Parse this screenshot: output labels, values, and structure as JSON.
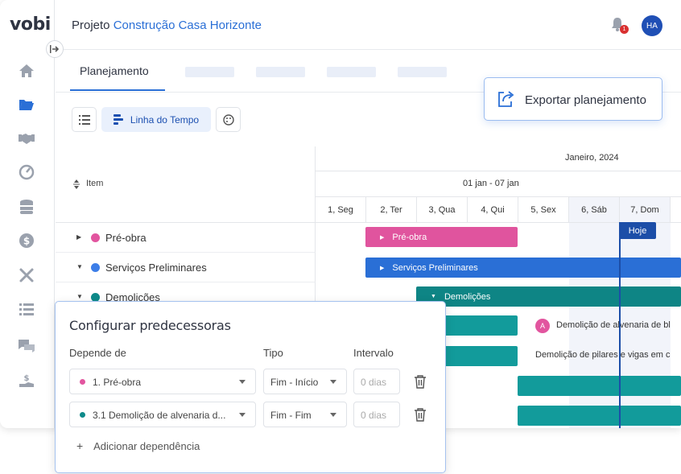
{
  "app": {
    "logo": "vobi"
  },
  "header": {
    "project_label": "Projeto",
    "project_name": "Construção Casa Horizonte",
    "notification_count": "1",
    "user_initials": "HA"
  },
  "tabs": {
    "active_label": "Planejamento"
  },
  "toolbar": {
    "timeline_label": "Linha do Tempo"
  },
  "export": {
    "label": "Exportar planejamento"
  },
  "grid": {
    "item_header": "Item",
    "month": "Janeiro, 2024",
    "week": "01 jan - 07 jan",
    "days": [
      "1, Seg",
      "2, Ter",
      "3, Qua",
      "4, Qui",
      "5, Sex",
      "6, Sáb",
      "7, Dom"
    ],
    "rows": [
      {
        "label": "Pré-obra",
        "color": "#e2559f",
        "expanded": false
      },
      {
        "label": "Serviços Preliminares",
        "color": "#3d7ee8",
        "expanded": true
      },
      {
        "label": "Demolições",
        "color": "#0e8a8a",
        "expanded": true
      }
    ],
    "bars": [
      {
        "label": "Pré-obra",
        "color": "#e0549e"
      },
      {
        "label": "Serviços Preliminares",
        "color": "#2a6fd6"
      },
      {
        "label": "Demolições",
        "color": "#0e8585"
      }
    ],
    "task_texts": [
      {
        "avatar": "A",
        "text": "Demolição de alvenaria de bl"
      },
      {
        "text": "Demolição de pilares e vigas em c"
      }
    ],
    "today_label": "Hoje"
  },
  "modal": {
    "title": "Configurar predecessoras",
    "col_depends": "Depende de",
    "col_type": "Tipo",
    "col_interval": "Intervalo",
    "rows": [
      {
        "depends": "1. Pré-obra",
        "dot_color": "#e2559f",
        "type": "Fim - Início",
        "interval_placeholder": "0 dias"
      },
      {
        "depends": "3.1 Demolição de alvenaria d...",
        "dot_color": "#0e8a8a",
        "type": "Fim - Fim",
        "interval_placeholder": "0 dias"
      }
    ],
    "add_label": "Adicionar dependência"
  }
}
